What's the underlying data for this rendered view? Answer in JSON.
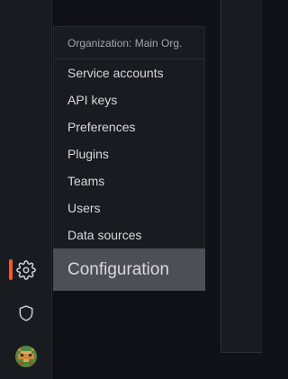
{
  "menu": {
    "header": "Organization: Main Org.",
    "items": [
      {
        "label": "Service accounts"
      },
      {
        "label": "API keys"
      },
      {
        "label": "Preferences"
      },
      {
        "label": "Plugins"
      },
      {
        "label": "Teams"
      },
      {
        "label": "Users"
      },
      {
        "label": "Data sources"
      }
    ],
    "section_title": "Configuration"
  },
  "sidebar": {
    "items": [
      {
        "icon": "gear-icon",
        "active": true
      },
      {
        "icon": "shield-icon",
        "active": false
      },
      {
        "icon": "user-avatar",
        "active": false
      }
    ],
    "accent_color": "#f05a28"
  },
  "colors": {
    "background": "#111217",
    "panel": "#181b1f",
    "menu_text": "#d8d9da",
    "header_text": "#9fa7b3",
    "highlight": "#4c4f56"
  }
}
